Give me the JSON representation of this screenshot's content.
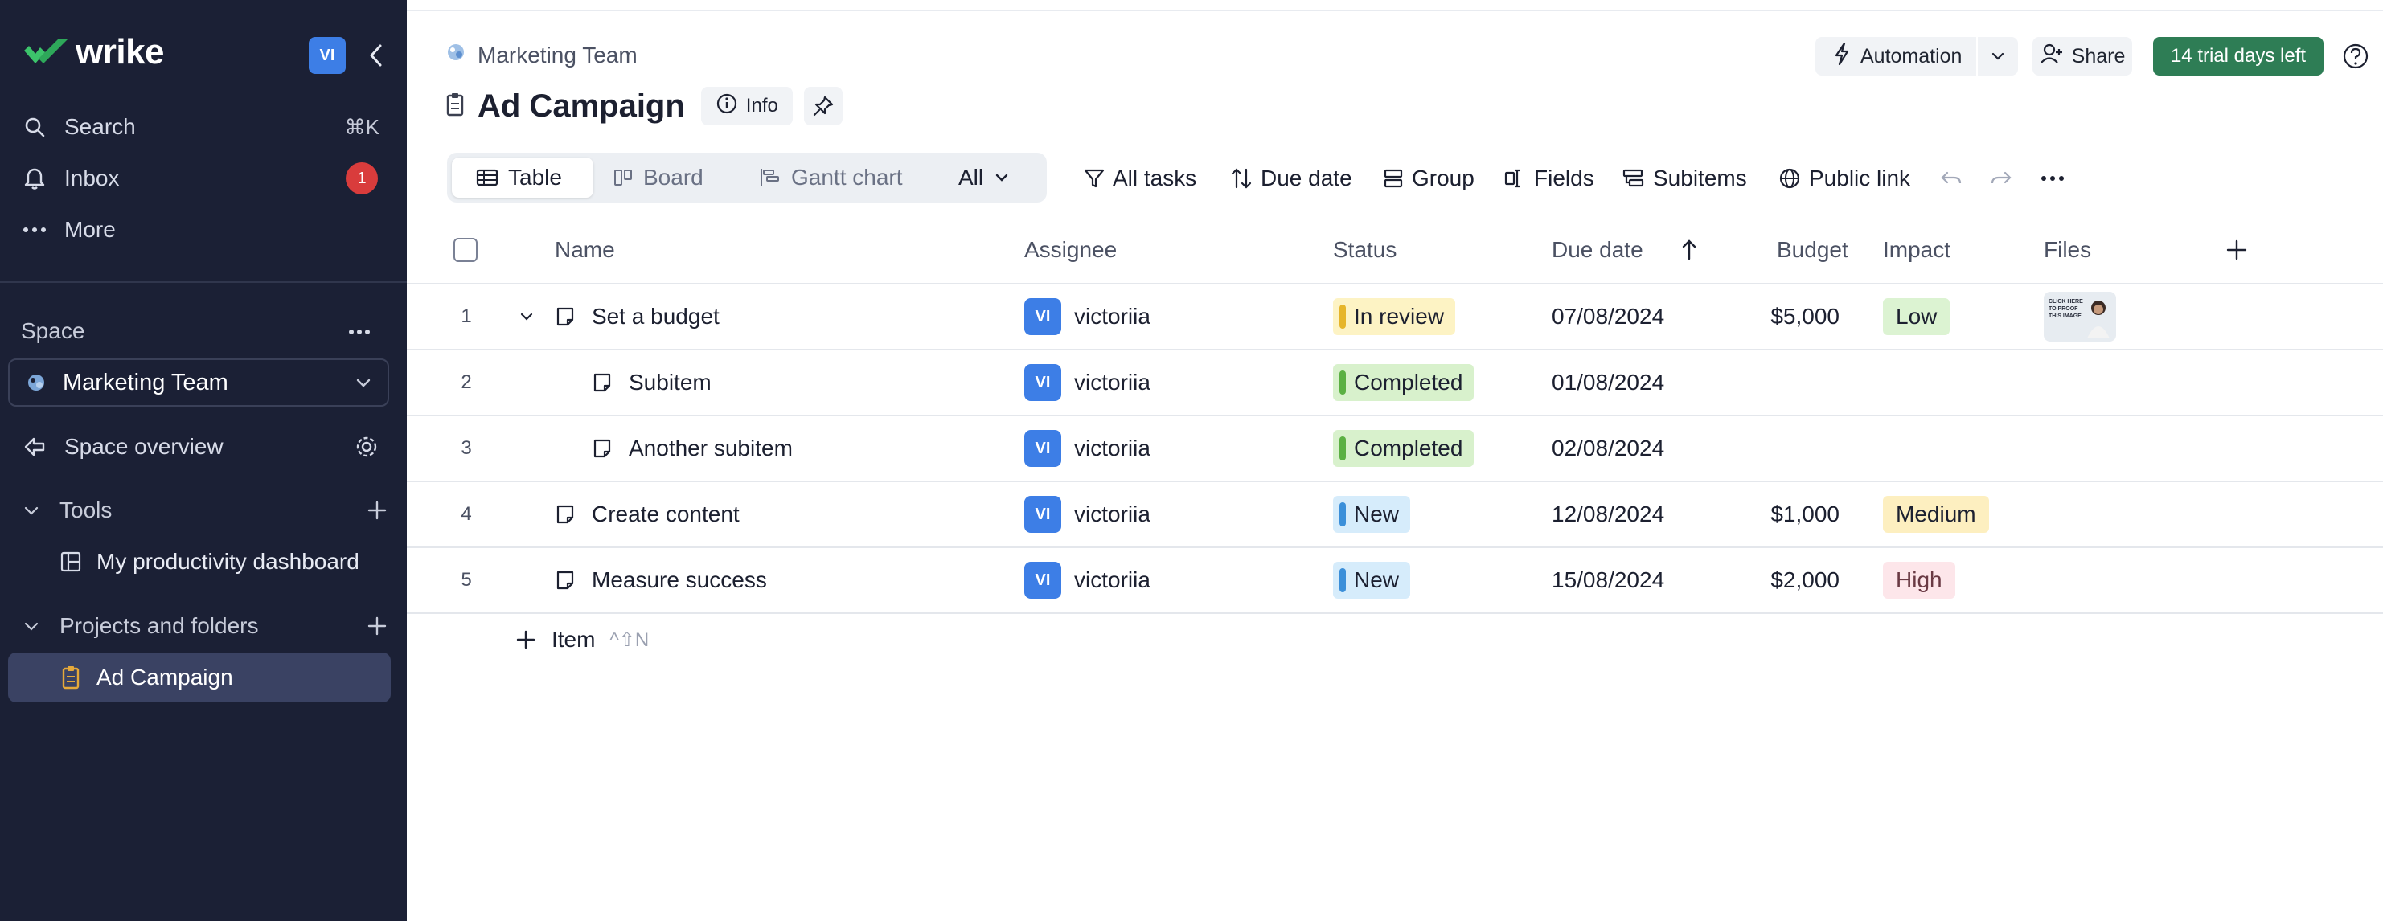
{
  "sidebar": {
    "logo_text": "wrike",
    "workspace_badge": "VI",
    "nav": [
      {
        "label": "Search",
        "icon": "search-icon",
        "shortcut": "⌘K"
      },
      {
        "label": "Inbox",
        "icon": "bell-icon",
        "count": "1"
      },
      {
        "label": "More",
        "icon": "more-icon"
      }
    ],
    "space_label": "Space",
    "space_selected": "Marketing Team",
    "space_overview": "Space overview",
    "tools_label": "Tools",
    "tools_items": [
      {
        "label": "My productivity dashboard"
      }
    ],
    "projects_label": "Projects and folders",
    "projects_items": [
      {
        "label": "Ad Campaign"
      }
    ]
  },
  "header": {
    "breadcrumb": "Marketing Team",
    "title": "Ad Campaign",
    "info_label": "Info",
    "automation_label": "Automation",
    "share_label": "Share",
    "trial_label": "14 trial days left"
  },
  "views": {
    "tabs": [
      {
        "label": "Table",
        "active": true
      },
      {
        "label": "Board"
      },
      {
        "label": "Gantt chart"
      },
      {
        "label": "All"
      }
    ]
  },
  "toolbar": {
    "all_tasks": "All tasks",
    "due_date": "Due date",
    "group": "Group",
    "fields": "Fields",
    "subitems": "Subitems",
    "public_link": "Public link"
  },
  "table": {
    "columns": {
      "name": "Name",
      "assignee": "Assignee",
      "status": "Status",
      "due_date": "Due date",
      "budget": "Budget",
      "impact": "Impact",
      "files": "Files"
    },
    "rows": [
      {
        "num": "1",
        "name": "Set a budget",
        "assignee_initials": "VI",
        "assignee": "victoriia",
        "status": "In review",
        "due": "07/08/2024",
        "budget": "$5,000",
        "impact": "Low"
      },
      {
        "num": "2",
        "name": "Subitem",
        "assignee_initials": "VI",
        "assignee": "victoriia",
        "status": "Completed",
        "due": "01/08/2024",
        "budget": "",
        "impact": ""
      },
      {
        "num": "3",
        "name": "Another subitem",
        "assignee_initials": "VI",
        "assignee": "victoriia",
        "status": "Completed",
        "due": "02/08/2024",
        "budget": "",
        "impact": ""
      },
      {
        "num": "4",
        "name": "Create content",
        "assignee_initials": "VI",
        "assignee": "victoriia",
        "status": "New",
        "due": "12/08/2024",
        "budget": "$1,000",
        "impact": "Medium"
      },
      {
        "num": "5",
        "name": "Measure success",
        "assignee_initials": "VI",
        "assignee": "victoriia",
        "status": "New",
        "due": "15/08/2024",
        "budget": "$2,000",
        "impact": "High"
      }
    ],
    "add_item_label": "Item",
    "add_item_shortcut": "^⇧N",
    "thumbnail_text": "CLICK HERE TO PROOF THIS IMAGE"
  },
  "colors": {
    "sidebar_bg": "#1b2035",
    "accent_blue": "#3d7ee6",
    "trial_green": "#2e7d55",
    "status_in_review": "#fdf3c4",
    "status_completed": "#d8f1cc",
    "status_new": "#d6ecfb",
    "impact_low": "#dcf3d2",
    "impact_medium": "#fdefc0",
    "impact_high": "#fde6ea"
  }
}
